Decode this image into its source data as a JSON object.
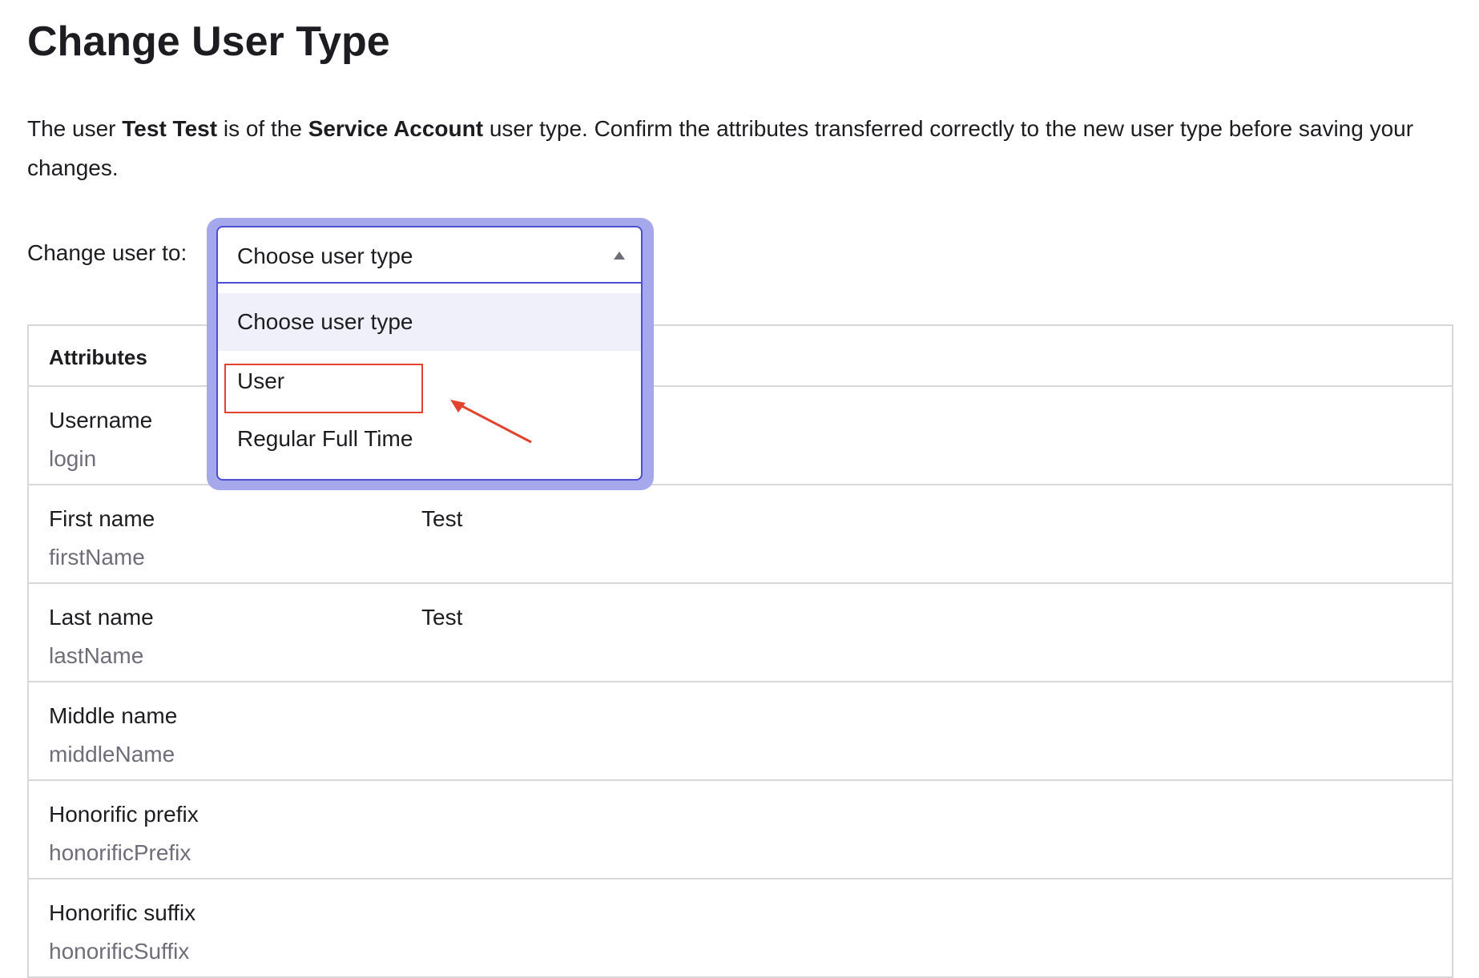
{
  "page": {
    "title": "Change User Type"
  },
  "intro": {
    "part1": "The user ",
    "user_name": "Test Test",
    "part2": " is of the ",
    "current_type": "Service Account",
    "part3": " user type. Confirm the attributes transferred correctly to the new user type before saving your changes."
  },
  "change_user": {
    "label": "Change user to:",
    "selected_value": "Choose user type",
    "options": [
      {
        "label": "Choose user type",
        "highlighted": true
      },
      {
        "label": "User",
        "highlighted": false
      },
      {
        "label": "Regular Full Time",
        "highlighted": false
      }
    ]
  },
  "table": {
    "header": "Attributes",
    "rows": [
      {
        "name": "Username",
        "key": "login",
        "value": ""
      },
      {
        "name": "First name",
        "key": "firstName",
        "value": "Test"
      },
      {
        "name": "Last name",
        "key": "lastName",
        "value": "Test"
      },
      {
        "name": "Middle name",
        "key": "middleName",
        "value": ""
      },
      {
        "name": "Honorific prefix",
        "key": "honorificPrefix",
        "value": ""
      },
      {
        "name": "Honorific suffix",
        "key": "honorificSuffix",
        "value": ""
      }
    ]
  },
  "colors": {
    "accent": "#4c4fd1",
    "focus_halo": "#a5a9ec",
    "annotation": "#e2432e",
    "border": "#d7d7dc"
  },
  "icons": {
    "dropdown_caret": "caret-up-icon"
  }
}
